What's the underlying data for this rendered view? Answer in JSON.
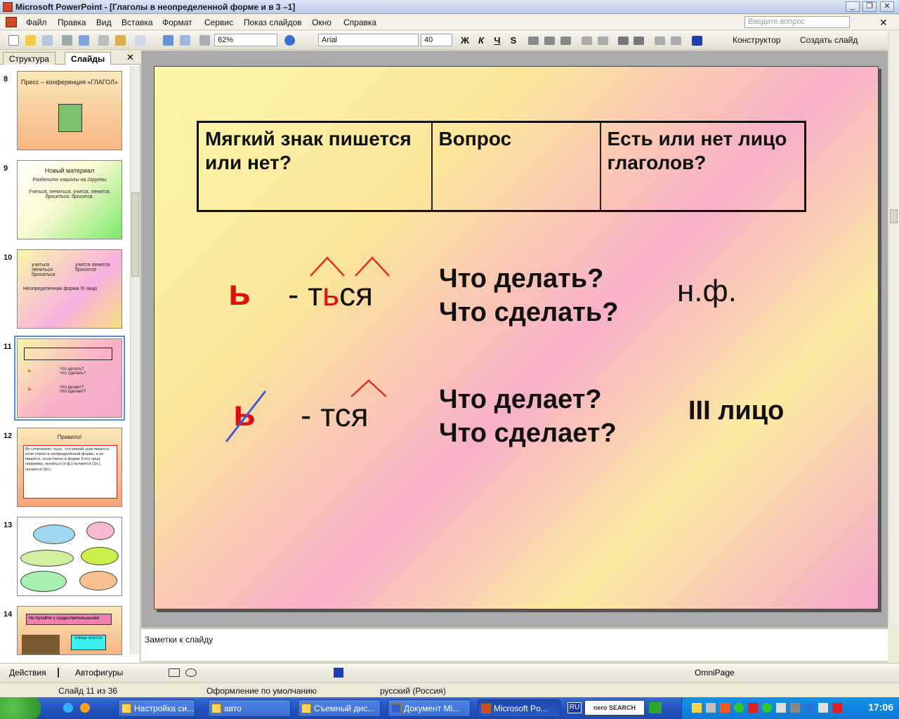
{
  "window": {
    "title": "Microsoft PowerPoint - [Глаголы в неопределенной форме и в 3 –1]"
  },
  "menu": {
    "items": [
      "Файл",
      "Правка",
      "Вид",
      "Вставка",
      "Формат",
      "Сервис",
      "Показ слайдов",
      "Окно",
      "Справка"
    ],
    "ask_placeholder": "Введите вопрос"
  },
  "toolbar": {
    "zoom": "62%",
    "font": "Arial",
    "size": "40",
    "bold": "Ж",
    "italic": "К",
    "underline": "Ч",
    "shadow": "S",
    "designer": "Конструктор",
    "new_slide": "Создать слайд"
  },
  "leftpane": {
    "tabs": [
      "Структура",
      "Слайды"
    ],
    "close": "✕",
    "slides": [
      {
        "num": "8",
        "text": "Пресс – конференция «ГЛАГОЛ»"
      },
      {
        "num": "9",
        "text": "Новый материал",
        "sub": "Разделите глаголы на 2группы",
        "body": "Учиться, лениться, учится, ленится, броситься, бросится."
      },
      {
        "num": "10",
        "text": "учиться лениться броситься",
        "sub": "учится ленится бросится",
        "body": "Неопределенная форма    III лицо"
      },
      {
        "num": "11",
        "text": ""
      },
      {
        "num": "12",
        "text": "Правило!",
        "body": "Во сочетаниях -ться, -тся мягкий знак пишется, если глагол в неопределённой форме, и не пишется, если глагол в форме 3-его лица: например, пытаться (н.ф.) пытаются (3л.), пытается (3л.)."
      },
      {
        "num": "13",
        "text": ""
      },
      {
        "num": "14",
        "text": "Не путайте с существительными!",
        "sub": "спица спится"
      }
    ]
  },
  "slide": {
    "table": {
      "headers": [
        "Мягкий знак пишется или нет?",
        "Вопрос",
        "Есть или нет лицо глаголов?"
      ]
    },
    "row1": {
      "sign": "ь",
      "ending": "- тЬся",
      "ending_pre": "- т",
      "ending_soft": "ь",
      "ending_post": "ся",
      "q1": "Что делать?",
      "q2": "Что сделать?",
      "label": "н.ф."
    },
    "row2": {
      "sign": "ь",
      "ending": "- тся",
      "q1": "Что делает?",
      "q2": "Что сделает?",
      "label": "III лицо"
    }
  },
  "notes": {
    "placeholder": "Заметки к слайду"
  },
  "drawbar": {
    "actions": "Действия",
    "autoshapes": "Автофигуры",
    "omnipage": "OmniPage"
  },
  "status": {
    "slide": "Слайд 11 из 36",
    "design": "Оформление по умолчанию",
    "lang": "русский (Россия)"
  },
  "taskbar": {
    "tasks": [
      "Настройка си...",
      "авто",
      "Съемный дис...",
      "Документ Mi...",
      "Microsoft Po..."
    ],
    "lang": "RU",
    "search": "nero SEARCH",
    "time": "17:06"
  }
}
